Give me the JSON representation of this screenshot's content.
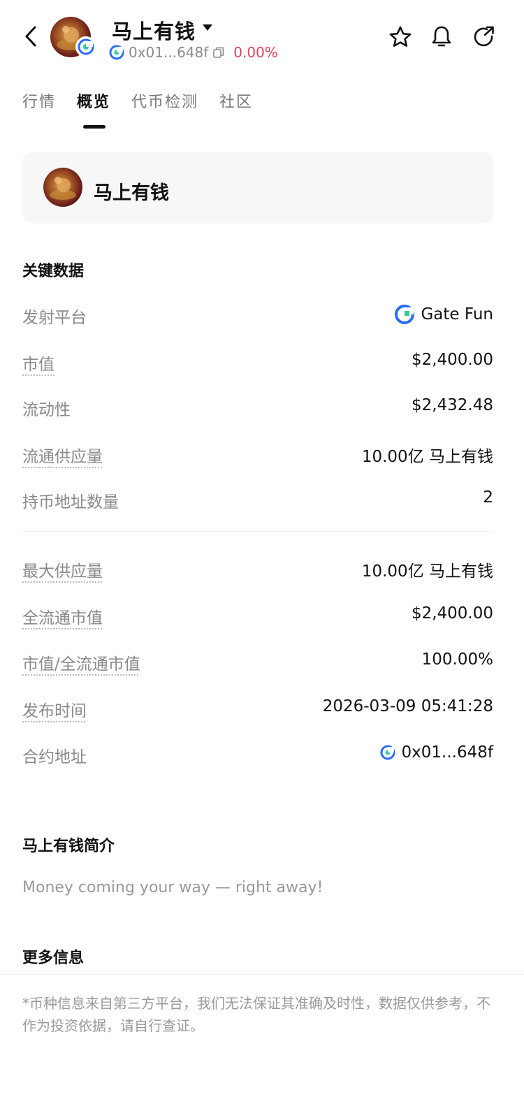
{
  "header": {
    "title": "马上有钱",
    "address": "0x01...648f",
    "change_pct": "0.00%",
    "icons": {
      "back": "chevron-left-icon",
      "dropdown": "caret-down-icon",
      "copy": "copy-icon",
      "favorite": "star-icon",
      "alert": "bell-icon",
      "share": "share-icon",
      "chain": "gate-chain-icon"
    }
  },
  "tabs": [
    {
      "label": "行情"
    },
    {
      "label": "概览"
    },
    {
      "label": "代币检测"
    },
    {
      "label": "社区"
    }
  ],
  "active_tab": 1,
  "token_card": {
    "name": "马上有钱"
  },
  "key_data": {
    "title": "关键数据",
    "rows": [
      {
        "label": "发射平台",
        "value": "Gate Fun"
      },
      {
        "label": "市值",
        "value": "$2,400.00"
      },
      {
        "label": "流动性",
        "value": "$2,432.48"
      },
      {
        "label": "流通供应量",
        "value": "10.00亿 马上有钱"
      },
      {
        "label": "持币地址数量",
        "value": "2"
      },
      {
        "label": "最大供应量",
        "value": "10.00亿 马上有钱"
      },
      {
        "label": "全流通市值",
        "value": "$2,400.00"
      },
      {
        "label": "市值/全流通市值",
        "value": "100.00%"
      },
      {
        "label": "发布时间",
        "value": "2026-03-09 05:41:28"
      },
      {
        "label": "合约地址",
        "value": "0x01...648f"
      }
    ]
  },
  "intro": {
    "title": "马上有钱简介",
    "text": "Money coming your way — right away!"
  },
  "more_info": {
    "title": "更多信息"
  },
  "disclaimer": "*币种信息来自第三方平台，我们无法保证其准确及时性，数据仅供参考，不作为投资依据，请自行查证。",
  "colors": {
    "accent_blue": "#2a6cf6",
    "negative_pink": "#e63d5c",
    "muted_text": "#8a8a8a"
  }
}
